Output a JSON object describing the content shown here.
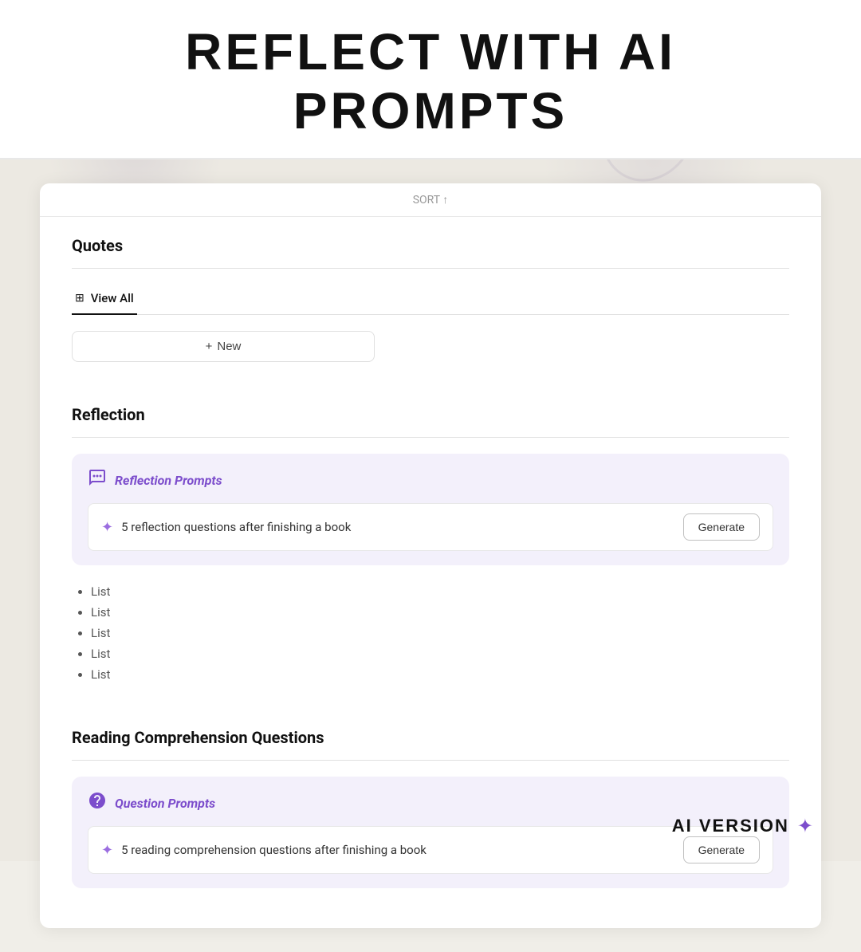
{
  "page": {
    "background_color": "#ece9e2",
    "title": "REFLECT WITH AI PROMPTS",
    "ai_version_label": "AI VERSION"
  },
  "card": {
    "top_bar_text": "SORT ↑",
    "sections": {
      "quotes": {
        "title": "Quotes",
        "tab": {
          "icon": "⊞",
          "label": "View All"
        },
        "new_button": {
          "icon": "+",
          "label": "New"
        }
      },
      "reflection": {
        "title": "Reflection",
        "prompt_card": {
          "icon": "💬",
          "title": "Reflection Prompts",
          "prompt_text": "5 reflection questions after finishing a book",
          "generate_button_label": "Generate"
        },
        "list_items": [
          "List",
          "List",
          "List",
          "List",
          "List"
        ]
      },
      "reading_comprehension": {
        "title": "Reading Comprehension Questions",
        "prompt_card": {
          "icon": "❓",
          "title": "Question Prompts",
          "prompt_text": "5 reading comprehension questions after finishing a book",
          "generate_button_label": "Generate"
        }
      }
    }
  }
}
